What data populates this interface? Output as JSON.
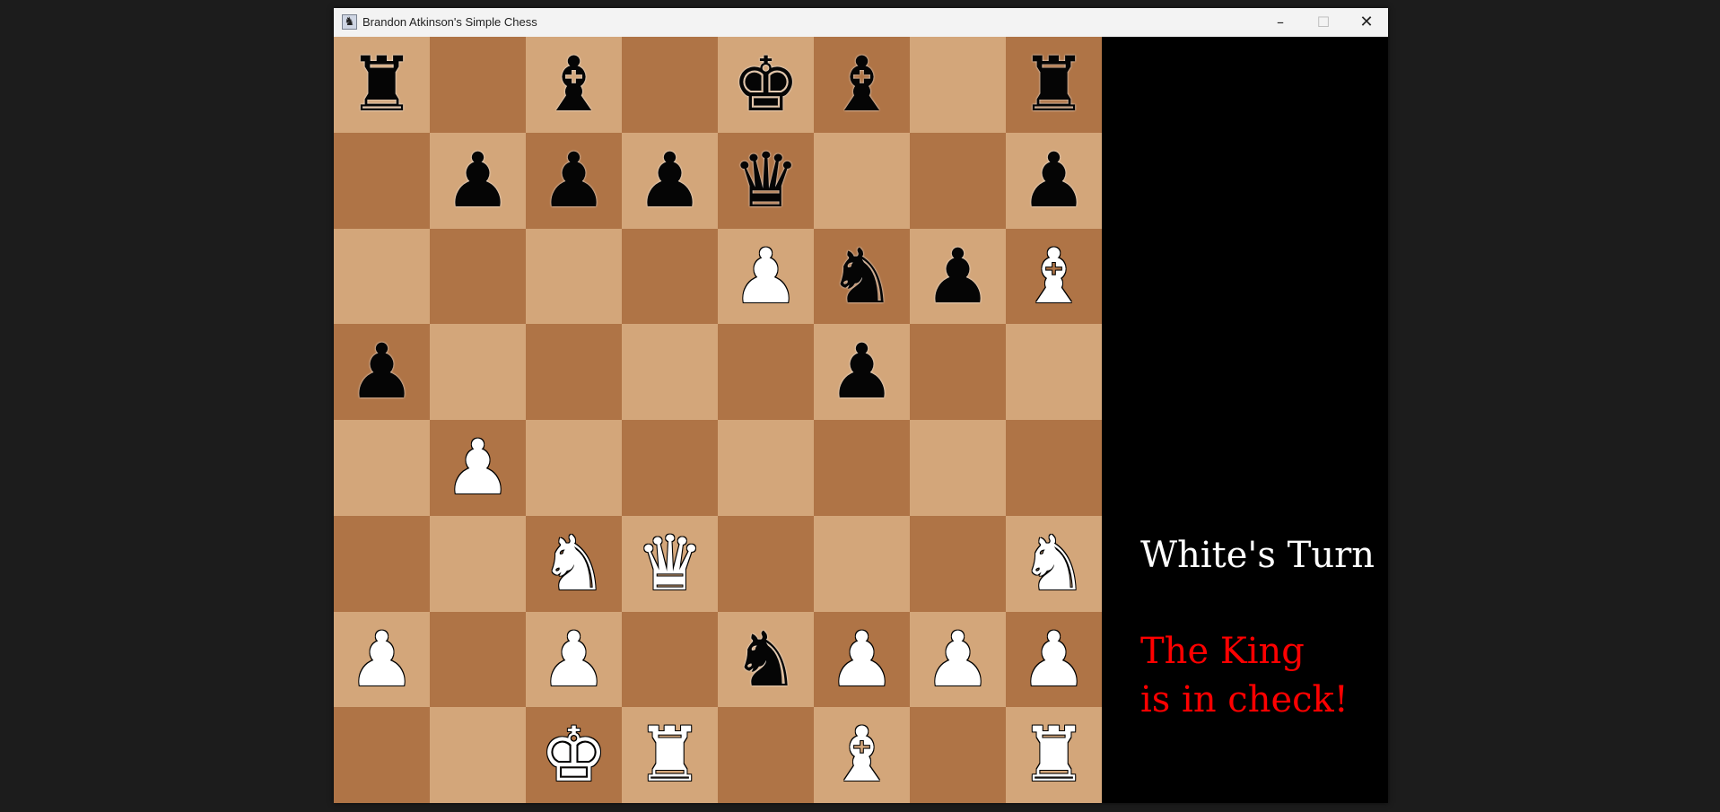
{
  "window": {
    "title": "Brandon Atkinson's Simple Chess",
    "app_icon": "chess-app-icon",
    "controls": {
      "minimize": "–",
      "maximize": "☐",
      "close": "✕"
    }
  },
  "board": {
    "light_color": "#d3a67a",
    "dark_color": "#af7446",
    "rows": [
      [
        "bR",
        "",
        "bB",
        "",
        "bK",
        "bB",
        "",
        "bR"
      ],
      [
        "",
        "bP",
        "bP",
        "bP",
        "bQ",
        "",
        "",
        "bP"
      ],
      [
        "",
        "",
        "",
        "",
        "wP",
        "bN",
        "bP",
        "wB"
      ],
      [
        "bP",
        "",
        "",
        "",
        "",
        "bP",
        "",
        ""
      ],
      [
        "",
        "wP",
        "",
        "",
        "",
        "",
        "",
        ""
      ],
      [
        "",
        "",
        "wN",
        "wQ",
        "",
        "",
        "",
        "wN"
      ],
      [
        "wP",
        "",
        "wP",
        "",
        "bN",
        "wP",
        "wP",
        "wP"
      ],
      [
        "",
        "",
        "wK",
        "wR",
        "",
        "wB",
        "",
        "wR"
      ]
    ]
  },
  "status": {
    "turn": "White's Turn",
    "check_line_1": "The King",
    "check_line_2": "is in check!",
    "check_color": "#ff0000"
  }
}
